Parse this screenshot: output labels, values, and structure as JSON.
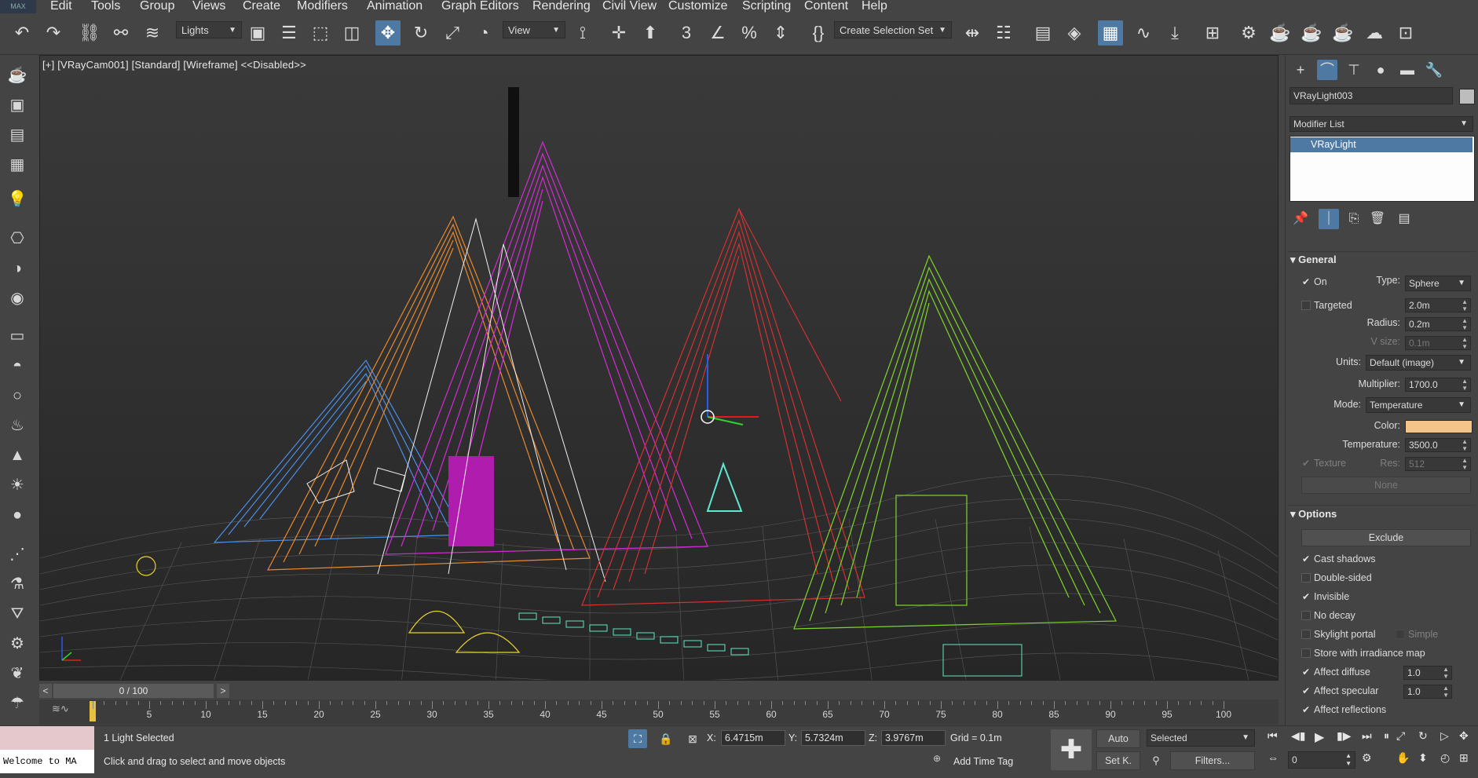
{
  "menu": [
    "Edit",
    "Tools",
    "Group",
    "Views",
    "Create",
    "Modifiers",
    "Animation",
    "Graph Editors",
    "Rendering",
    "Civil View",
    "Customize",
    "Scripting",
    "Content",
    "Help"
  ],
  "app_logo": "MAX",
  "toolbar": {
    "selection_filter": "Lights",
    "reference_coord": "View",
    "named_selection": "Create Selection Set"
  },
  "viewport": {
    "label": "[+] [VRayCam001] [Standard] [Wireframe] <<Disabled>>"
  },
  "command_panel": {
    "object_name": "VRayLight003",
    "modifier_list": "Modifier List",
    "stack_items": [
      "VRayLight"
    ],
    "general": {
      "title": "General",
      "on_label": "On",
      "type_label": "Type:",
      "type_value": "Sphere",
      "targeted_label": "Targeted",
      "targeted_value": "2.0m",
      "radius_label": "Radius:",
      "radius_value": "0.2m",
      "vsize_label": "V size:",
      "vsize_value": "0.1m",
      "units_label": "Units:",
      "units_value": "Default (image)",
      "multiplier_label": "Multiplier:",
      "multiplier_value": "1700.0",
      "mode_label": "Mode:",
      "mode_value": "Temperature",
      "color_label": "Color:",
      "color_swatch": "#f5c48b",
      "temperature_label": "Temperature:",
      "temperature_value": "3500.0",
      "texture_label": "Texture",
      "res_label": "Res:",
      "res_value": "512",
      "none_button": "None"
    },
    "options": {
      "title": "Options",
      "exclude_button": "Exclude",
      "cast_shadows": "Cast shadows",
      "double_sided": "Double-sided",
      "invisible": "Invisible",
      "no_decay": "No decay",
      "skylight_portal": "Skylight portal",
      "simple": "Simple",
      "store_irradiance": "Store with irradiance map",
      "affect_diffuse": "Affect diffuse",
      "affect_diffuse_value": "1.0",
      "affect_specular": "Affect specular",
      "affect_specular_value": "1.0",
      "affect_reflections": "Affect reflections"
    }
  },
  "timeline": {
    "frame_counter": "0 / 100",
    "ticks": [
      "5",
      "10",
      "15",
      "20",
      "25",
      "30",
      "35",
      "40",
      "45",
      "50",
      "55",
      "60",
      "65",
      "70",
      "75",
      "80",
      "85",
      "90",
      "95",
      "100"
    ]
  },
  "status": {
    "maxscript": "Welcome to MA",
    "selection": "1 Light Selected",
    "prompt": "Click and drag to select and move objects",
    "x_label": "X:",
    "x_value": "6.4715m",
    "y_label": "Y:",
    "y_value": "5.7324m",
    "z_label": "Z:",
    "z_value": "3.9767m",
    "grid": "Grid = 0.1m",
    "add_time_tag": "Add Time Tag",
    "auto_button": "Auto",
    "setkey_button": "Set K.",
    "key_filter": "Selected",
    "filters_button": "Filters...",
    "frame_value": "0"
  },
  "colors": {
    "accent": "#4d79a3",
    "viewport_bg": "#2f2f2f",
    "selected_stack": "#4d79a3"
  }
}
